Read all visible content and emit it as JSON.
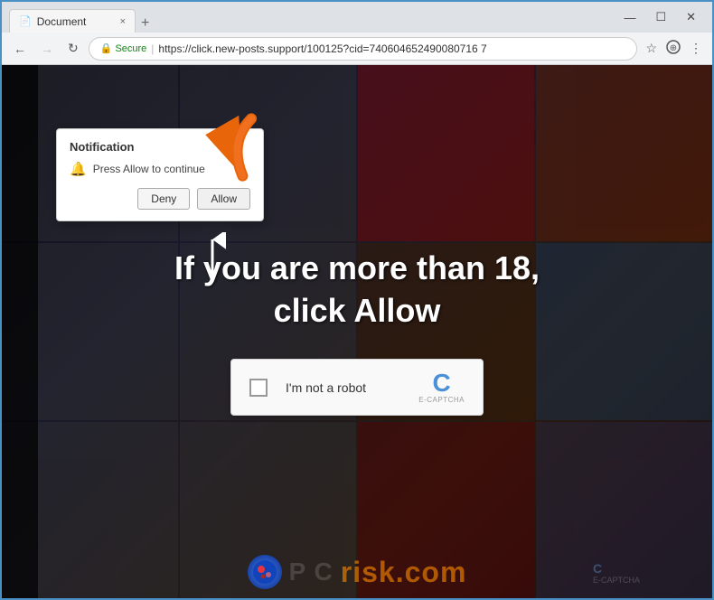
{
  "browser": {
    "tab": {
      "title": "Document",
      "close_label": "×"
    },
    "new_tab_label": "+",
    "window_controls": {
      "minimize": "—",
      "maximize": "☐",
      "close": "✕"
    },
    "nav": {
      "back": "←",
      "forward": "→",
      "refresh": "↻"
    },
    "address_bar": {
      "secure_label": "Secure",
      "url": "https://click.new-posts.support/100125?cid=740604652490080716 7"
    },
    "icons": {
      "star": "☆",
      "extensions": "⊞",
      "menu": "⋮",
      "lock": "🔒"
    }
  },
  "notification_popup": {
    "title": "Notification",
    "message": "Press Allow to continue",
    "deny_label": "Deny",
    "allow_label": "Allow"
  },
  "page": {
    "headline_line1": "If you are more than 18,",
    "headline_line2": "click Allow",
    "captcha_label": "I'm not a robot",
    "captcha_logo": "C",
    "captcha_brand": "E-CAPTCHA"
  },
  "watermark": {
    "domain": "risk.com"
  }
}
